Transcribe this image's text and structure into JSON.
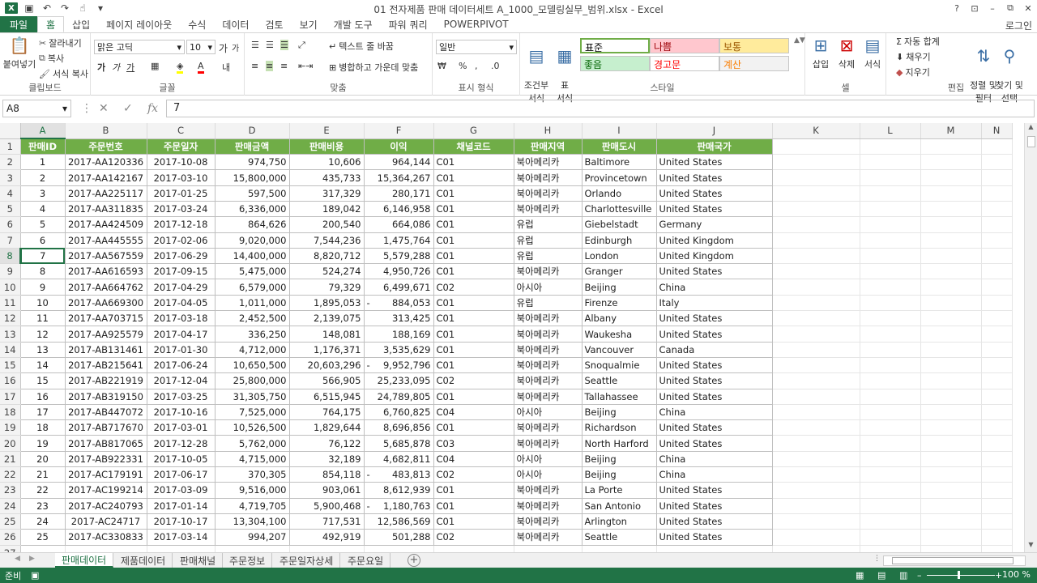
{
  "window": {
    "title": "01 전자제품 판매 데이터세트 A_1000_모델링실무_범위.xlsx - Excel",
    "controls": [
      "?",
      "⊡",
      "–",
      "⧉",
      "✕"
    ]
  },
  "ribbon_tabs": [
    "파일",
    "홈",
    "삽입",
    "페이지 레이아웃",
    "수식",
    "데이터",
    "검토",
    "보기",
    "개발 도구",
    "파워 쿼리",
    "POWERPIVOT"
  ],
  "login": "로그인",
  "ribbon": {
    "clipboard": {
      "paste": "붙여넣기",
      "cut": "잘라내기",
      "copy": "복사",
      "format_painter": "서식 복사",
      "label": "클립보드"
    },
    "font": {
      "font_name": "맑은 고딕",
      "font_size": "10",
      "grow": "가",
      "shrink": "가",
      "bold": "가",
      "italic": "가",
      "underline": "가",
      "label": "글꼴"
    },
    "alignment": {
      "wrap_text": "텍스트 줄 바꿈",
      "merge_center": "병합하고 가운데 맞춤",
      "label": "맞춤"
    },
    "number": {
      "format": "일반",
      "percent": "%",
      "comma": ",",
      "label": "표시 형식"
    },
    "styles": {
      "conditional": "조건부\n서식",
      "table": "표\n서식",
      "cells": [
        {
          "text": "표준",
          "bg": "#ffffff",
          "fg": "#000000"
        },
        {
          "text": "나쁨",
          "bg": "#ffc7ce",
          "fg": "#9c0006"
        },
        {
          "text": "보통",
          "bg": "#ffeb9c",
          "fg": "#9c5700"
        },
        {
          "text": "좋음",
          "bg": "#c6efce",
          "fg": "#006100"
        },
        {
          "text": "경고문",
          "bg": "#ffffff",
          "fg": "#ff0000"
        },
        {
          "text": "계산",
          "bg": "#f2f2f2",
          "fg": "#fa7d00"
        }
      ],
      "label": "스타일"
    },
    "cells": {
      "insert": "삽입",
      "delete": "삭제",
      "format": "서식",
      "label": "셀"
    },
    "editing": {
      "autosum": "자동 합계",
      "fill": "채우기",
      "clear": "지우기",
      "sort_filter": "정렬 및\n필터",
      "find_select": "찾기 및\n선택",
      "label": "편집"
    }
  },
  "formula_bar": {
    "name_box": "A8",
    "fx": "fx",
    "value": "7"
  },
  "columns": [
    "A",
    "B",
    "C",
    "D",
    "E",
    "F",
    "G",
    "H",
    "I",
    "J",
    "K",
    "L",
    "M",
    "N"
  ],
  "selected": {
    "column": "A",
    "row": 8
  },
  "headers": [
    "판매ID",
    "주문번호",
    "주문일자",
    "판매금액",
    "판매비용",
    "이익",
    "채널코드",
    "판매지역",
    "판매도시",
    "판매국가"
  ],
  "rows": [
    [
      "1",
      "2017-AA120336",
      "2017-10-08",
      "974,750",
      "10,606",
      "964,144",
      "C01",
      "북아메리카",
      "Baltimore",
      "United States"
    ],
    [
      "2",
      "2017-AA142167",
      "2017-03-10",
      "15,800,000",
      "435,733",
      "15,364,267",
      "C01",
      "북아메리카",
      "Provincetown",
      "United States"
    ],
    [
      "3",
      "2017-AA225117",
      "2017-01-25",
      "597,500",
      "317,329",
      "280,171",
      "C01",
      "북아메리카",
      "Orlando",
      "United States"
    ],
    [
      "4",
      "2017-AA311835",
      "2017-03-24",
      "6,336,000",
      "189,042",
      "6,146,958",
      "C01",
      "북아메리카",
      "Charlottesville",
      "United States"
    ],
    [
      "5",
      "2017-AA424509",
      "2017-12-18",
      "864,626",
      "200,540",
      "664,086",
      "C01",
      "유럽",
      "Giebelstadt",
      "Germany"
    ],
    [
      "6",
      "2017-AA445555",
      "2017-02-06",
      "9,020,000",
      "7,544,236",
      "1,475,764",
      "C01",
      "유럽",
      "Edinburgh",
      "United Kingdom"
    ],
    [
      "7",
      "2017-AA567559",
      "2017-06-29",
      "14,400,000",
      "8,820,712",
      "5,579,288",
      "C01",
      "유럽",
      "London",
      "United Kingdom"
    ],
    [
      "8",
      "2017-AA616593",
      "2017-09-15",
      "5,475,000",
      "524,274",
      "4,950,726",
      "C01",
      "북아메리카",
      "Granger",
      "United States"
    ],
    [
      "9",
      "2017-AA664762",
      "2017-04-29",
      "6,579,000",
      "79,329",
      "6,499,671",
      "C02",
      "아시아",
      "Beijing",
      "China"
    ],
    [
      "10",
      "2017-AA669300",
      "2017-04-05",
      "1,011,000",
      "1,895,053",
      "-|884,053",
      "C01",
      "유럽",
      "Firenze",
      "Italy"
    ],
    [
      "11",
      "2017-AA703715",
      "2017-03-18",
      "2,452,500",
      "2,139,075",
      "313,425",
      "C01",
      "북아메리카",
      "Albany",
      "United States"
    ],
    [
      "12",
      "2017-AA925579",
      "2017-04-17",
      "336,250",
      "148,081",
      "188,169",
      "C01",
      "북아메리카",
      "Waukesha",
      "United States"
    ],
    [
      "13",
      "2017-AB131461",
      "2017-01-30",
      "4,712,000",
      "1,176,371",
      "3,535,629",
      "C01",
      "북아메리카",
      "Vancouver",
      "Canada"
    ],
    [
      "14",
      "2017-AB215641",
      "2017-06-24",
      "10,650,500",
      "20,603,296",
      "-|9,952,796",
      "C01",
      "북아메리카",
      "Snoqualmie",
      "United States"
    ],
    [
      "15",
      "2017-AB221919",
      "2017-12-04",
      "25,800,000",
      "566,905",
      "25,233,095",
      "C02",
      "북아메리카",
      "Seattle",
      "United States"
    ],
    [
      "16",
      "2017-AB319150",
      "2017-03-25",
      "31,305,750",
      "6,515,945",
      "24,789,805",
      "C01",
      "북아메리카",
      "Tallahassee",
      "United States"
    ],
    [
      "17",
      "2017-AB447072",
      "2017-10-16",
      "7,525,000",
      "764,175",
      "6,760,825",
      "C04",
      "아시아",
      "Beijing",
      "China"
    ],
    [
      "18",
      "2017-AB717670",
      "2017-03-01",
      "10,526,500",
      "1,829,644",
      "8,696,856",
      "C01",
      "북아메리카",
      "Richardson",
      "United States"
    ],
    [
      "19",
      "2017-AB817065",
      "2017-12-28",
      "5,762,000",
      "76,122",
      "5,685,878",
      "C03",
      "북아메리카",
      "North Harford",
      "United States"
    ],
    [
      "20",
      "2017-AB922331",
      "2017-10-05",
      "4,715,000",
      "32,189",
      "4,682,811",
      "C04",
      "아시아",
      "Beijing",
      "China"
    ],
    [
      "21",
      "2017-AC179191",
      "2017-06-17",
      "370,305",
      "854,118",
      "-|483,813",
      "C02",
      "아시아",
      "Beijing",
      "China"
    ],
    [
      "22",
      "2017-AC199214",
      "2017-03-09",
      "9,516,000",
      "903,061",
      "8,612,939",
      "C01",
      "북아메리카",
      "La Porte",
      "United States"
    ],
    [
      "23",
      "2017-AC240793",
      "2017-01-14",
      "4,719,705",
      "5,900,468",
      "-|1,180,763",
      "C01",
      "북아메리카",
      "San Antonio",
      "United States"
    ],
    [
      "24",
      "2017-AC24717",
      "2017-10-17",
      "13,304,100",
      "717,531",
      "12,586,569",
      "C01",
      "북아메리카",
      "Arlington",
      "United States"
    ],
    [
      "25",
      "2017-AC330833",
      "2017-03-14",
      "994,207",
      "492,919",
      "501,288",
      "C02",
      "북아메리카",
      "Seattle",
      "United States"
    ]
  ],
  "sheets": [
    "판매데이터",
    "제품데이터",
    "판매채널",
    "주문정보",
    "주문일자상세",
    "주문요일"
  ],
  "active_sheet": 0,
  "status": {
    "ready": "준비",
    "zoom": "100 %"
  }
}
